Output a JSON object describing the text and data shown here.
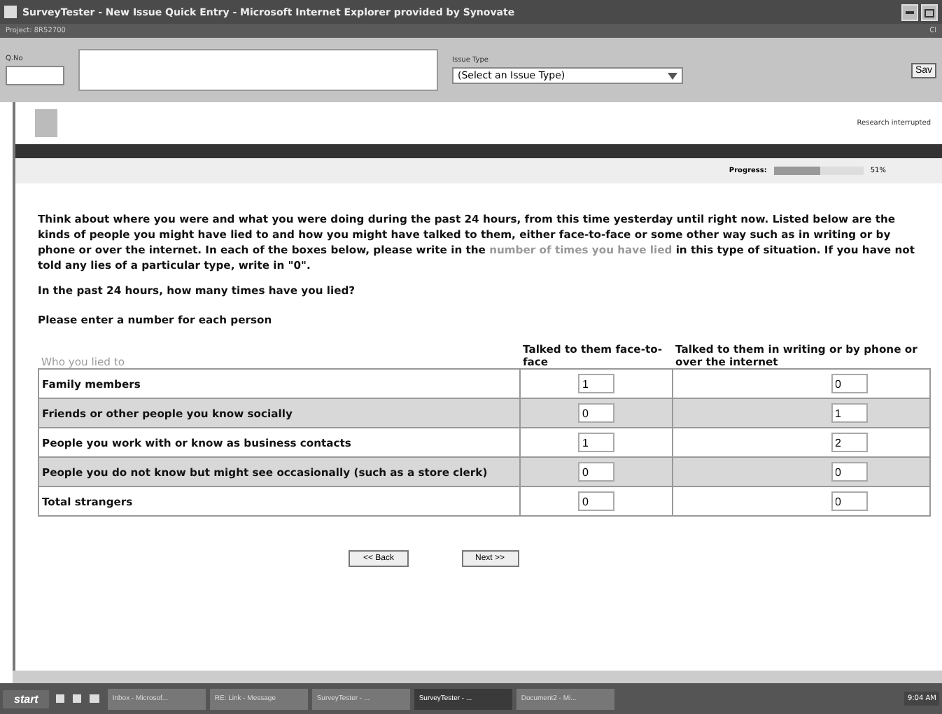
{
  "window": {
    "title": "SurveyTester - New Issue Quick Entry - Microsoft Internet Explorer provided by Synovate"
  },
  "project_bar": {
    "project": "Project: 8R52700",
    "right_text": "Cl"
  },
  "issue_bar": {
    "qno_label": "Q.No",
    "issue_type_label": "Issue Type",
    "issue_type_value": "(Select an Issue Type)",
    "save_button": "Sav"
  },
  "header": {
    "right_text": "Research interrupted"
  },
  "progress": {
    "label": "Progress:",
    "level": 0.51,
    "reading": "51%"
  },
  "intro": {
    "before": "Think about where you were and what you were doing during the past 24 hours, from this time yesterday until right now. Listed below are the kinds of people you might have lied to and how you might have talked to them, either face-to-face or some other way such as in writing or by phone or over the internet. In each of the boxes below, please write in the",
    "link": "number of times you have lied",
    "after": "in this type of situation. If you have not told any lies of a particular type, write in \"0\"."
  },
  "question": "In the past 24 hours, how many times have you lied?",
  "instruction": "Please enter a number for each person",
  "table": {
    "columns": [
      "Who you lied to",
      "Talked to them face-to-face",
      "Talked to them in writing or by phone or over the internet"
    ],
    "rows": [
      {
        "label": "Family members",
        "face": "1",
        "remote": "0"
      },
      {
        "label": "Friends or other people you know socially",
        "face": "0",
        "remote": "1"
      },
      {
        "label": "People you work with or know as business contacts",
        "face": "1",
        "remote": "2"
      },
      {
        "label": "People you do not know but might see occasionally (such as a store clerk)",
        "face": "0",
        "remote": "0"
      },
      {
        "label": "Total strangers",
        "face": "0",
        "remote": "0"
      }
    ]
  },
  "buttons": [
    "<< Back",
    "Next >>"
  ],
  "taskbar": {
    "start": "start",
    "tasks": [
      {
        "label": "Inbox - Microsof...",
        "selected": false
      },
      {
        "label": "RE: Link - Message",
        "selected": false
      },
      {
        "label": "SurveyTester - ...",
        "selected": false
      },
      {
        "label": "SurveyTester - ...",
        "selected": true
      },
      {
        "label": "Document2 - Mi...",
        "selected": false
      }
    ],
    "clock": "9:04 AM"
  }
}
